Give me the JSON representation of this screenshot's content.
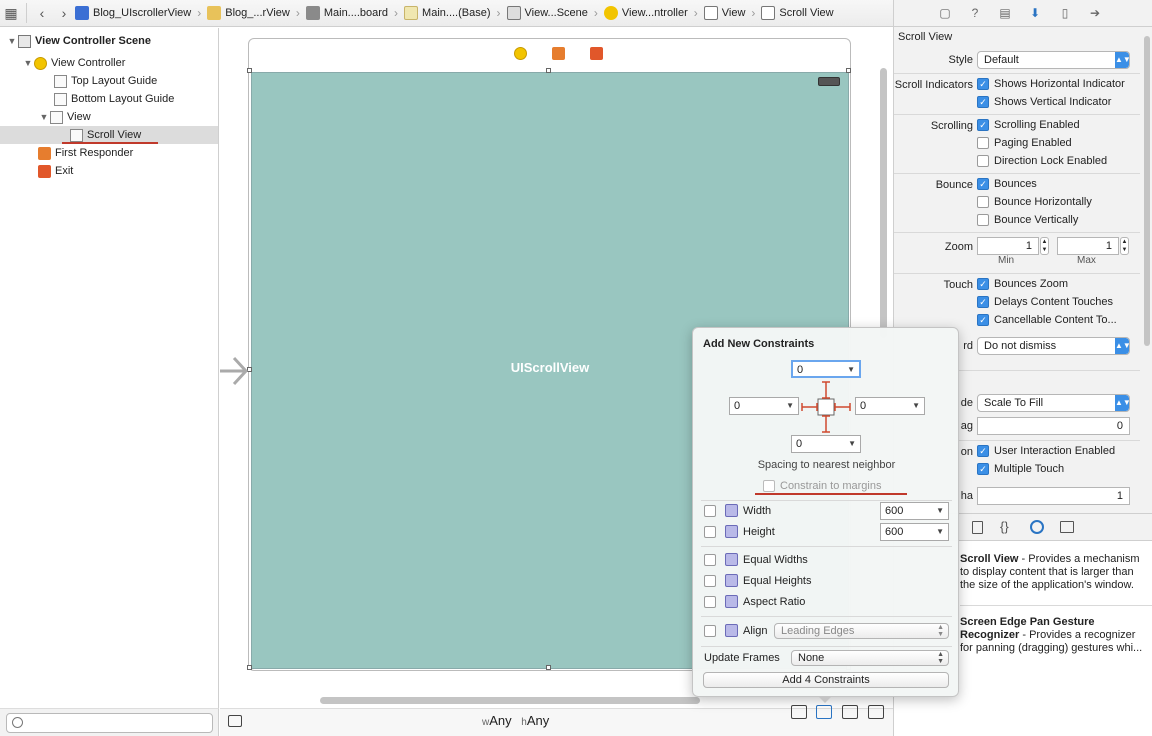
{
  "jumpbar": {
    "crumbs": [
      "Blog_UIscrollerView",
      "Blog_...rView",
      "Main....board",
      "Main....(Base)",
      "View...Scene",
      "View...ntroller",
      "View",
      "Scroll View"
    ]
  },
  "outline": {
    "items": [
      {
        "label": "View Controller Scene",
        "bold": true
      },
      {
        "label": "View Controller"
      },
      {
        "label": "Top Layout Guide"
      },
      {
        "label": "Bottom Layout Guide"
      },
      {
        "label": "View"
      },
      {
        "label": "Scroll View",
        "selected": true
      },
      {
        "label": "First Responder"
      },
      {
        "label": "Exit"
      }
    ]
  },
  "canvas": {
    "scroll_label": "UIScrollView",
    "size_class": {
      "w_prefix": "w",
      "w_value": "Any",
      "h_prefix": "h",
      "h_value": "Any"
    }
  },
  "inspector": {
    "section_title": "Scroll View",
    "style": {
      "label": "Style",
      "value": "Default"
    },
    "indicators": {
      "label": "Scroll Indicators",
      "horizontal": "Shows Horizontal Indicator",
      "vertical": "Shows Vertical Indicator"
    },
    "scrolling": {
      "label": "Scrolling",
      "enabled": "Scrolling Enabled",
      "paging": "Paging Enabled",
      "direction_lock": "Direction Lock Enabled"
    },
    "bounce": {
      "label": "Bounce",
      "bounces": "Bounces",
      "horizontally": "Bounce Horizontally",
      "vertically": "Bounce Vertically"
    },
    "zoom": {
      "label": "Zoom",
      "min": "1",
      "max": "1",
      "min_label": "Min",
      "max_label": "Max"
    },
    "touch": {
      "label": "Touch",
      "bounces_zoom": "Bounces Zoom",
      "delays": "Delays Content Touches",
      "cancellable": "Cancellable Content To..."
    },
    "keyboard": {
      "label_fragment": "rd",
      "value": "Do not dismiss"
    },
    "mode": {
      "label_fragment": "de",
      "value": "Scale To Fill"
    },
    "tag": {
      "label_fragment": "ag",
      "value": "0"
    },
    "interaction": {
      "label_fragment": "on",
      "user": "User Interaction Enabled",
      "multi": "Multiple Touch"
    },
    "alpha": {
      "label_fragment": "ha",
      "value": "1"
    },
    "library": [
      {
        "title": "Scroll View",
        "desc": " - Provides a mechanism to display content that is larger than the size of the application's window."
      },
      {
        "title": "Screen Edge Pan Gesture Recognizer",
        "desc": " - Provides a recognizer for panning (dragging) gestures whi..."
      }
    ]
  },
  "popover": {
    "title": "Add New Constraints",
    "top": "0",
    "left": "0",
    "right": "0",
    "bottom": "0",
    "spacing_label": "Spacing to nearest neighbor",
    "margins_label": "Constrain to margins",
    "width_label": "Width",
    "width_value": "600",
    "height_label": "Height",
    "height_value": "600",
    "equal_widths": "Equal Widths",
    "equal_heights": "Equal Heights",
    "aspect_ratio": "Aspect Ratio",
    "align_label": "Align",
    "align_value": "Leading Edges",
    "update_frames_label": "Update Frames",
    "update_frames_value": "None",
    "add_button": "Add 4 Constraints"
  },
  "colors": {
    "accent": "#3b8fe6",
    "scroll_bg": "#99c6c0",
    "highlight": "#c0392b"
  }
}
